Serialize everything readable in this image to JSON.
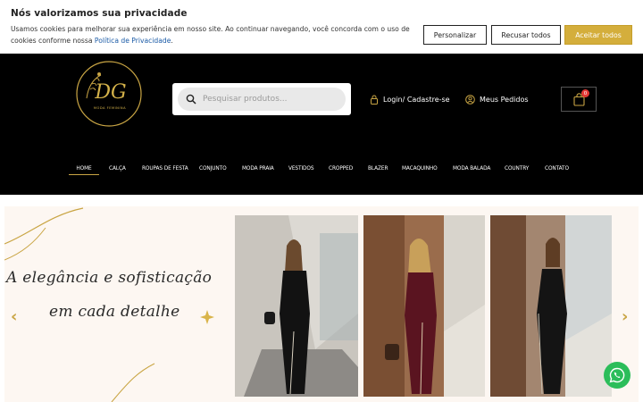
{
  "cookie": {
    "title": "Nós valorizamos sua privacidade",
    "text": "Usamos cookies para melhorar sua experiência em nosso site. Ao continuar navegando, você concorda com o uso de cookies conforme nossa ",
    "link": "Política de Privacidade",
    "text_end": ".",
    "personalize": "Personalizar",
    "reject": "Recusar todos",
    "accept": "Aceitar todos"
  },
  "header": {
    "logo_initials": "DG",
    "logo_subtitle": "MODA FEMININA",
    "search_placeholder": "Pesquisar produtos...",
    "login": "Login/ Cadastre-se",
    "orders": "Meus Pedidos",
    "cart_count": "0"
  },
  "nav": [
    "HOME",
    "CALÇA",
    "ROUPAS DE FESTA",
    "CONJUNTO",
    "MODA PRAIA",
    "VESTIDOS",
    "CROPPED",
    "BLAZER",
    "MACAQUINHO",
    "MODA BALADA",
    "COUNTRY",
    "CONTATO"
  ],
  "hero": {
    "line1": "A elegância e sofisticação",
    "line2": "em cada detalhe",
    "prev": "‹",
    "next": "›"
  },
  "colors": {
    "accent": "#d4ae3c",
    "header_bg": "#000000",
    "hero_bg": "#fdf7f2",
    "whatsapp": "#2bbd5a"
  }
}
